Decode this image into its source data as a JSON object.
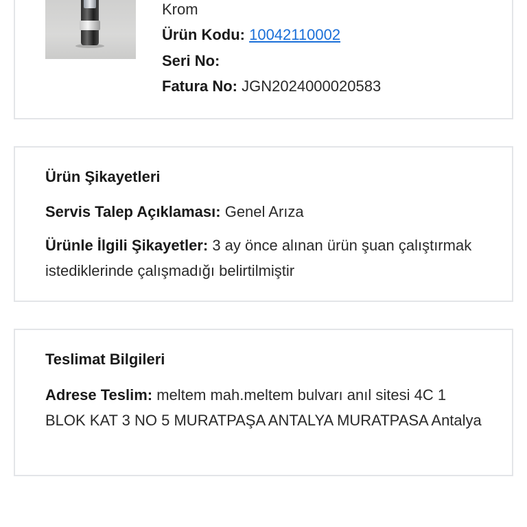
{
  "product": {
    "color": "Krom",
    "code_label": "Ürün Kodu:",
    "code_value": "10042110002",
    "serial_label": "Seri No:",
    "serial_value": "",
    "invoice_label": "Fatura No:",
    "invoice_value": "JGN2024000020583",
    "image_icon": "blender-product-image"
  },
  "complaints": {
    "title": "Ürün Şikayetleri",
    "request_label": "Servis Talep Açıklaması:",
    "request_value": "Genel Arıza",
    "complaint_label": "Ürünle İlgili Şikayetler:",
    "complaint_value": "3 ay önce alınan ürün şuan çalıştırmak istediklerinde çalışmadığı belirtilmiştir"
  },
  "delivery": {
    "title": "Teslimat Bilgileri",
    "address_label": "Adrese Teslim:",
    "address_value": "meltem mah.meltem bulvarı anıl sitesi 4C 1 BLOK KAT 3 NO 5 MURATPAŞA ANTALYA MURATPASA Antalya"
  },
  "colors": {
    "link": "#1a6fd8",
    "card_border": "#e3e5e8"
  }
}
